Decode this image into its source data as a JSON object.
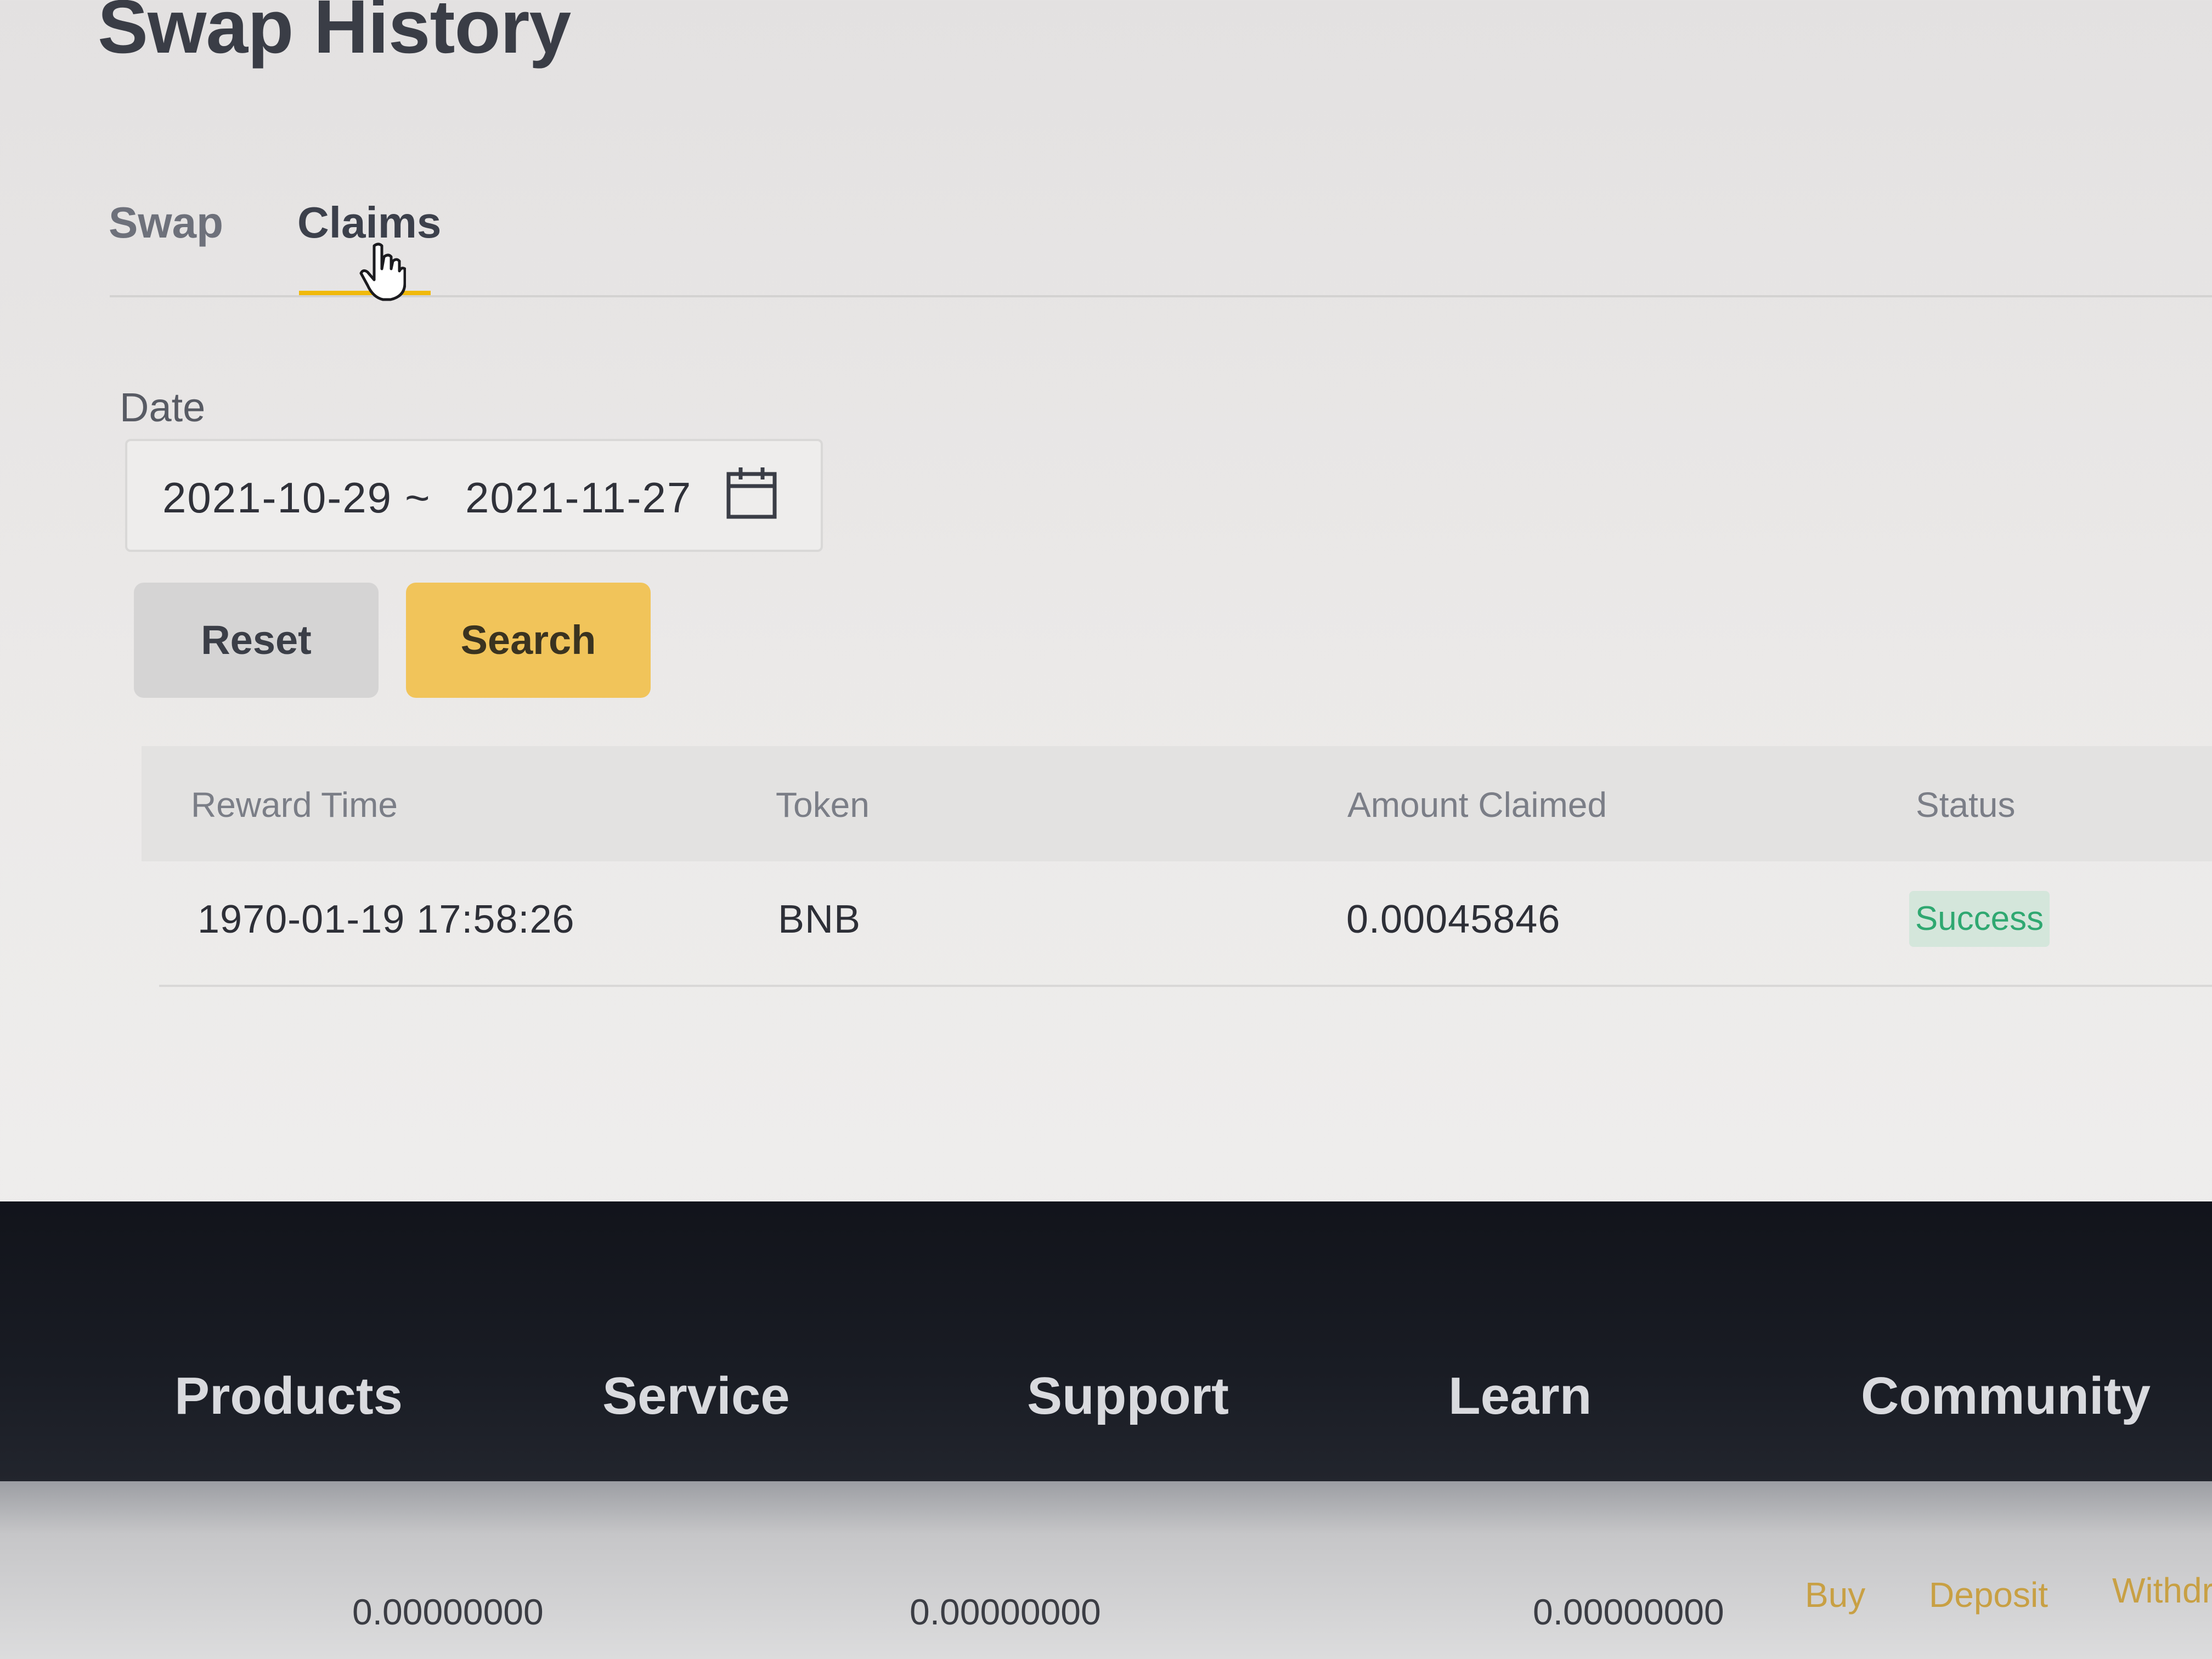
{
  "page": {
    "title": "Swap History"
  },
  "tabs": [
    {
      "label": "Swap",
      "active": false
    },
    {
      "label": "Claims",
      "active": true
    }
  ],
  "filters": {
    "date_label": "Date",
    "start_date": "2021-10-29",
    "separator": "~",
    "end_date": "2021-11-27",
    "reset_label": "Reset",
    "search_label": "Search"
  },
  "table": {
    "columns": [
      "Reward Time",
      "Token",
      "Amount Claimed",
      "Status"
    ],
    "rows": [
      {
        "reward_time": "1970-01-19 17:58:26",
        "token": "BNB",
        "amount": "0.00045846",
        "status": "Success"
      }
    ]
  },
  "footer": {
    "nav": [
      "Products",
      "Service",
      "Support",
      "Learn",
      "Community"
    ]
  },
  "bottom_row": {
    "balances": [
      "0.00000000",
      "0.00000000",
      "0.00000000"
    ],
    "actions": [
      "Buy",
      "Deposit",
      "Withdr"
    ]
  },
  "colors": {
    "accent": "#f0b90b",
    "search_button": "#f1c45a",
    "success_text": "#2fa871",
    "success_bg": "#d4e6db",
    "footer_bg": "#15171e"
  },
  "icons": {
    "date_picker": "calendar-icon",
    "pointer": "hand-cursor-icon"
  }
}
